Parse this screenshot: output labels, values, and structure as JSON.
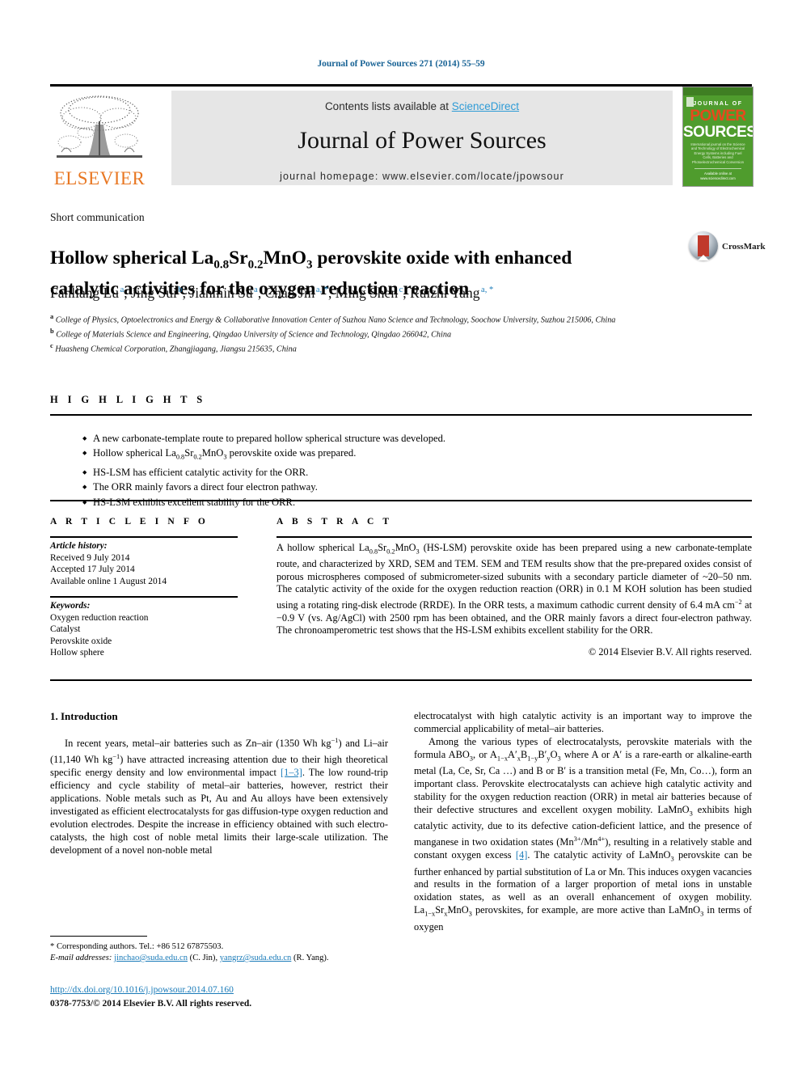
{
  "running_head": "Journal of Power Sources 271 (2014) 55–59",
  "masthead": {
    "contents_prefix": "Contents lists available at ",
    "sciencedirect": "ScienceDirect",
    "journal_title": "Journal of Power Sources",
    "homepage": "journal homepage: www.elsevier.com/locate/jpowsour",
    "publisher_logo_text": "ELSEVIER",
    "cover": {
      "line1": "JOURNAL OF",
      "line2": "POWER",
      "line3": "SOURCES",
      "subtitle": "International journal on the Science and Technology of Electrochemical Energy Systems including Fuel Cells, Batteries and Photoelectrochemical Conversion",
      "footer": "Available online at www.sciencedirect.com"
    },
    "cover_color": "#4f9c2d",
    "band_color": "#e6e6e6",
    "link_color": "#2e9bd6",
    "elsevier_orange": "#E87722"
  },
  "article_type": "Short communication",
  "title_parts": {
    "p1": "Hollow spherical La",
    "sub1": "0.8",
    "p2": "Sr",
    "sub2": "0.2",
    "p3": "MnO",
    "sub3": "3",
    "p4": " perovskite oxide with enhanced catalytic activities for the oxygen reduction reaction"
  },
  "crossmark_label": "CrossMark",
  "authors": [
    {
      "name": "Fanliang Lu",
      "marks": "a"
    },
    {
      "name": "Jing Sui",
      "marks": "b"
    },
    {
      "name": "Jianmin Su",
      "marks": "a"
    },
    {
      "name": "Chao Jin",
      "marks": "a, *"
    },
    {
      "name": "Ming Shen",
      "marks": "c"
    },
    {
      "name": "Ruizhi Yang",
      "marks": "a, *"
    }
  ],
  "affiliations": [
    {
      "mark": "a",
      "text": "College of Physics, Optoelectronics and Energy & Collaborative Innovation Center of Suzhou Nano Science and Technology, Soochow University, Suzhou 215006, China"
    },
    {
      "mark": "b",
      "text": "College of Materials Science and Engineering, Qingdao University of Science and Technology, Qingdao 266042, China"
    },
    {
      "mark": "c",
      "text": "Huasheng Chemical Corporation, Zhangjiagang, Jiangsu 215635, China"
    }
  ],
  "highlights": {
    "heading": "H I G H L I G H T S",
    "items": [
      {
        "pre": "A new carbonate-template route to prepared hollow spherical structure was developed.",
        "sub": null,
        "post": null
      },
      {
        "pre": "Hollow spherical La",
        "sub": "0.8",
        "mid": "Sr",
        "sub2": "0.2",
        "mid2": "MnO",
        "sub3": "3",
        "post": " perovskite oxide was prepared."
      },
      {
        "pre": "HS-LSM has efficient catalytic activity for the ORR.",
        "sub": null,
        "post": null
      },
      {
        "pre": "The ORR mainly favors a direct four electron pathway.",
        "sub": null,
        "post": null
      },
      {
        "pre": "HS-LSM exhibits excellent stability for the ORR.",
        "sub": null,
        "post": null
      }
    ]
  },
  "article_info": {
    "heading": "A R T I C L E  I N F O",
    "history_label": "Article history:",
    "history": [
      "Received 9 July 2014",
      "Accepted 17 July 2014",
      "Available online 1 August 2014"
    ],
    "keywords_label": "Keywords:",
    "keywords": [
      "Oxygen reduction reaction",
      "Catalyst",
      "Perovskite oxide",
      "Hollow sphere"
    ]
  },
  "abstract": {
    "heading": "A B S T R A C T",
    "text_1": "A hollow spherical La",
    "sub_1": "0.8",
    "text_2": "Sr",
    "sub_2": "0.2",
    "text_3": "MnO",
    "sub_3": "3",
    "text_4": " (HS-LSM) perovskite oxide has been prepared using a new carbonate-template route, and characterized by XRD, SEM and TEM. SEM and TEM results show that the pre-prepared oxides consist of porous microspheres composed of submicrometer-sized subunits with a secondary particle diameter of ~20–50 nm. The catalytic activity of the oxide for the oxygen reduction reaction (ORR) in 0.1 M KOH solution has been studied using a rotating ring-disk electrode (RRDE). In the ORR tests, a maximum cathodic current density of 6.4 mA cm",
    "sup_1": "−2",
    "text_5": " at −0.9 V (vs. Ag/AgCl) with 2500 rpm has been obtained, and the ORR mainly favors a direct four-electron pathway. The chronoamperometric test shows that the HS-LSM exhibits excellent stability for the ORR.",
    "copyright": "© 2014 Elsevier B.V. All rights reserved."
  },
  "body": {
    "section_heading": "1. Introduction",
    "left_para_1_a": "In recent years, metal–air batteries such as Zn–air (1350 Wh kg",
    "left_para_1_sup1": "−1",
    "left_para_1_b": ") and Li–air (11,140 Wh kg",
    "left_para_1_sup2": "−1",
    "left_para_1_c": ") have attracted increasing attention due to their high theoretical specific energy density and low environmental impact ",
    "left_ref_1": "[1–3]",
    "left_para_1_d": ". The low round-trip efficiency and cycle stability of metal–air batteries, however, restrict their applications. Noble metals such as Pt, Au and Au alloys have been extensively investigated as efficient electrocatalysts for gas diffusion-type oxygen reduction and evolution electrodes. Despite the increase in efficiency obtained with such electro-catalysts, the high cost of noble metal limits their large-scale utilization. The development of a novel non-noble metal",
    "right_para_1": "electrocatalyst with high catalytic activity is an important way to improve the commercial applicability of metal–air batteries.",
    "right_para_2_a": "Among the various types of electrocatalysts, perovskite materials with the formula ABO",
    "right_para_2_sub1": "3",
    "right_para_2_b": ", or A",
    "right_para_2_sub2": "1−x",
    "right_para_2_c": "A′",
    "right_para_2_sub3": "x",
    "right_para_2_d": "B",
    "right_para_2_sub4": "1−y",
    "right_para_2_e": "B′",
    "right_para_2_sub5": "y",
    "right_para_2_f": "O",
    "right_para_2_sub6": "3",
    "right_para_2_g": " where A or A′ is a rare-earth or alkaline-earth metal (La, Ce, Sr, Ca …) and B or B′ is a transition metal (Fe, Mn, Co…), form an important class. Perovskite electrocatalysts can achieve high catalytic activity and stability for the oxygen reduction reaction (ORR) in metal air batteries because of their defective structures and excellent oxygen mobility. LaMnO",
    "right_para_2_sub7": "3",
    "right_para_2_h": " exhibits high catalytic activity, due to its defective cation-deficient lattice, and the presence of manganese in two oxidation states (Mn",
    "right_para_2_sup1": "3+",
    "right_para_2_i": "/Mn",
    "right_para_2_sup2": "4+",
    "right_para_2_j": "), resulting in a relatively stable and constant oxygen excess ",
    "right_ref_1": "[4]",
    "right_para_2_k": ". The catalytic activity of LaMnO",
    "right_para_2_sub8": "3",
    "right_para_2_l": " perovskite can be further enhanced by partial substitution of La or Mn. This induces oxygen vacancies and results in the formation of a larger proportion of metal ions in unstable oxidation states, as well as an overall enhancement of oxygen mobility. La",
    "right_para_2_sub9": "1−x",
    "right_para_2_m": "Sr",
    "right_para_2_sub10": "x",
    "right_para_2_n": "MnO",
    "right_para_2_sub11": "3",
    "right_para_2_o": " perovskites, for example, are more active than LaMnO",
    "right_para_2_sub12": "3",
    "right_para_2_p": " in terms of oxygen"
  },
  "footer": {
    "corresponding": "* Corresponding authors. Tel.: +86 512 67875503.",
    "email_label": "E-mail addresses:",
    "email_1": "jinchao@suda.edu.cn",
    "email_1_owner": " (C. Jin), ",
    "email_2": "yangrz@suda.edu.cn",
    "email_2_owner": " (R. Yang).",
    "doi": "http://dx.doi.org/10.1016/j.jpowsour.2014.07.160",
    "issn": "0378-7753/© 2014 Elsevier B.V. All rights reserved."
  }
}
